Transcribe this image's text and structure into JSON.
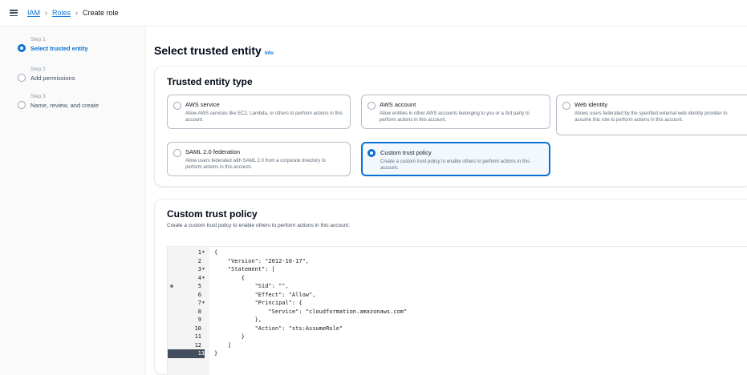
{
  "breadcrumb": {
    "items": [
      "IAM",
      "Roles",
      "Create role"
    ]
  },
  "steps": [
    {
      "number": "Step 1",
      "label": "Select trusted entity",
      "active": true
    },
    {
      "number": "Step 2",
      "label": "Add permissions",
      "active": false
    },
    {
      "number": "Step 3",
      "label": "Name, review, and create",
      "active": false
    }
  ],
  "page": {
    "title": "Select trusted entity",
    "info_label": "Info"
  },
  "trusted_entity": {
    "title": "Trusted entity type",
    "options": [
      {
        "title": "AWS service",
        "desc": "Allow AWS services like EC2, Lambda, or others to perform actions in this account.",
        "selected": false
      },
      {
        "title": "AWS account",
        "desc": "Allow entities in other AWS accounts belonging to you or a 3rd party to perform actions in this account.",
        "selected": false
      },
      {
        "title": "Web identity",
        "desc": "Allows users federated by the specified external web identity provider to assume this role to perform actions in this account.",
        "selected": false
      },
      {
        "title": "SAML 2.0 federation",
        "desc": "Allow users federated with SAML 2.0 from a corporate directory to perform actions in this account.",
        "selected": false
      },
      {
        "title": "Custom trust policy",
        "desc": "Create a custom trust policy to enable others to perform actions in this account.",
        "selected": true
      }
    ]
  },
  "custom_policy": {
    "title": "Custom trust policy",
    "desc": "Create a custom trust policy to enable others to perform actions in this account.",
    "line_numbers": [
      "1",
      "2",
      "3",
      "4",
      "5",
      "6",
      "7",
      "8",
      "9",
      "10",
      "11",
      "12",
      "13"
    ],
    "lines": [
      "{",
      "    \"Version\": \"2012-10-17\",",
      "    \"Statement\": [",
      "        {",
      "            \"Sid\": \"\",",
      "            \"Effect\": \"Allow\",",
      "            \"Principal\": {",
      "                \"Service\": \"cloudformation.amazonaws.com\"",
      "            },",
      "            \"Action\": \"sts:AssumeRole\"",
      "        }",
      "    ]",
      "}"
    ]
  },
  "colors": {
    "accent": "#0972d3",
    "selected_bg": "#f2f8fd",
    "text": "#16191f"
  }
}
